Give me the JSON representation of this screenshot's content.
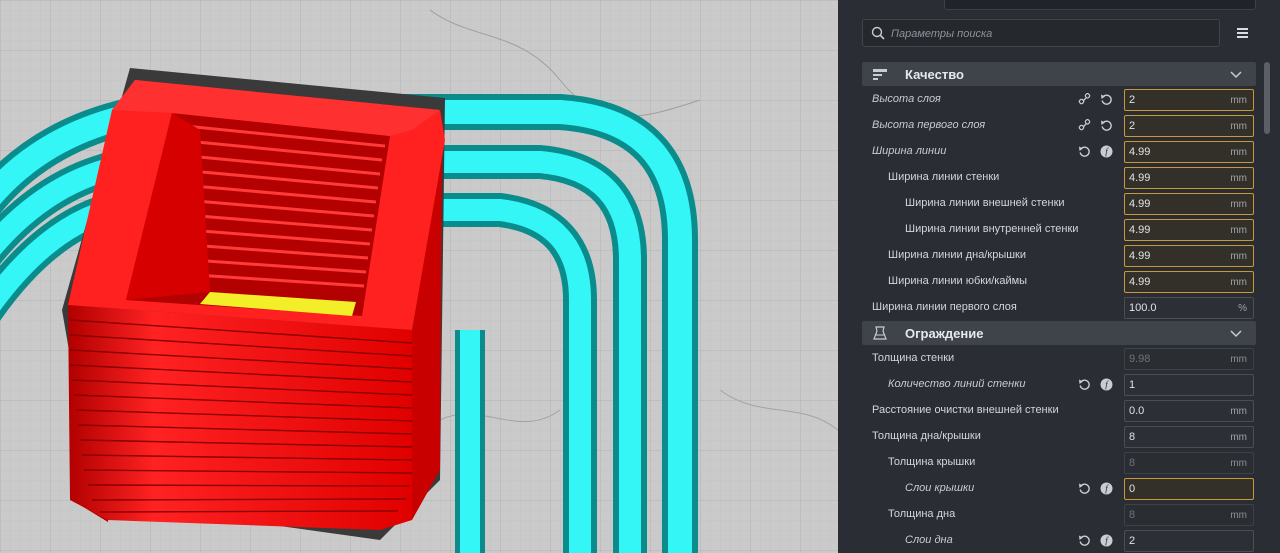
{
  "search": {
    "placeholder": "Параметры поиска"
  },
  "sections": {
    "quality": {
      "title": "Качество",
      "icon": "quality-icon"
    },
    "walls": {
      "title": "Ограждение",
      "icon": "walls-icon"
    }
  },
  "settings": [
    {
      "label": "Высота слоя",
      "value": "2",
      "unit": "mm",
      "italic": true,
      "icons": [
        "link-icon",
        "reset-icon"
      ],
      "state": "changed"
    },
    {
      "label": "Высота первого слоя",
      "value": "2",
      "unit": "mm",
      "italic": true,
      "icons": [
        "link-icon",
        "reset-icon"
      ],
      "state": "changed"
    },
    {
      "label": "Ширина линии",
      "value": "4.99",
      "unit": "mm",
      "italic": true,
      "icons": [
        "reset-icon",
        "function-icon"
      ],
      "state": "changed"
    },
    {
      "label": "Ширина линии стенки",
      "value": "4.99",
      "unit": "mm",
      "italic": false,
      "icons": [],
      "state": "changed"
    },
    {
      "label": "Ширина линии внешней стенки",
      "value": "4.99",
      "unit": "mm",
      "italic": false,
      "icons": [],
      "state": "changed"
    },
    {
      "label": "Ширина линии внутренней стенки",
      "value": "4.99",
      "unit": "mm",
      "italic": false,
      "icons": [],
      "state": "changed"
    },
    {
      "label": "Ширина линии дна/крышки",
      "value": "4.99",
      "unit": "mm",
      "italic": false,
      "icons": [],
      "state": "changed"
    },
    {
      "label": "Ширина линии юбки/каймы",
      "value": "4.99",
      "unit": "mm",
      "italic": false,
      "icons": [],
      "state": "changed"
    },
    {
      "label": "Ширина линии первого слоя",
      "value": "100.0",
      "unit": "%",
      "italic": false,
      "icons": [],
      "state": "normal"
    },
    {
      "label": "Толщина стенки",
      "value": "9.98",
      "unit": "mm",
      "italic": false,
      "icons": [],
      "state": "disabled"
    },
    {
      "label": "Количество линий стенки",
      "value": "1",
      "unit": "",
      "italic": true,
      "icons": [
        "reset-icon",
        "function-icon"
      ],
      "state": "normal"
    },
    {
      "label": "Расстояние очистки внешней стенки",
      "value": "0.0",
      "unit": "mm",
      "italic": false,
      "icons": [],
      "state": "normal"
    },
    {
      "label": "Толщина дна/крышки",
      "value": "8",
      "unit": "mm",
      "italic": false,
      "icons": [],
      "state": "normal"
    },
    {
      "label": "Толщина крышки",
      "value": "8",
      "unit": "mm",
      "italic": false,
      "icons": [],
      "state": "disabled"
    },
    {
      "label": "Слои крышки",
      "value": "0",
      "unit": "",
      "italic": true,
      "icons": [
        "reset-icon",
        "function-icon"
      ],
      "state": "changed"
    },
    {
      "label": "Толщина дна",
      "value": "8",
      "unit": "mm",
      "italic": false,
      "icons": [],
      "state": "disabled"
    },
    {
      "label": "Слои дна",
      "value": "2",
      "unit": "",
      "italic": true,
      "icons": [
        "reset-icon",
        "function-icon"
      ],
      "state": "normal"
    }
  ],
  "colors": {
    "model": "#ff1a1a",
    "skirt": "#19f2f2",
    "infill": "#f2ef28",
    "changed_border": "#c69a3c",
    "panel_bg": "#2a2d33",
    "section_bg": "#3f434a"
  }
}
